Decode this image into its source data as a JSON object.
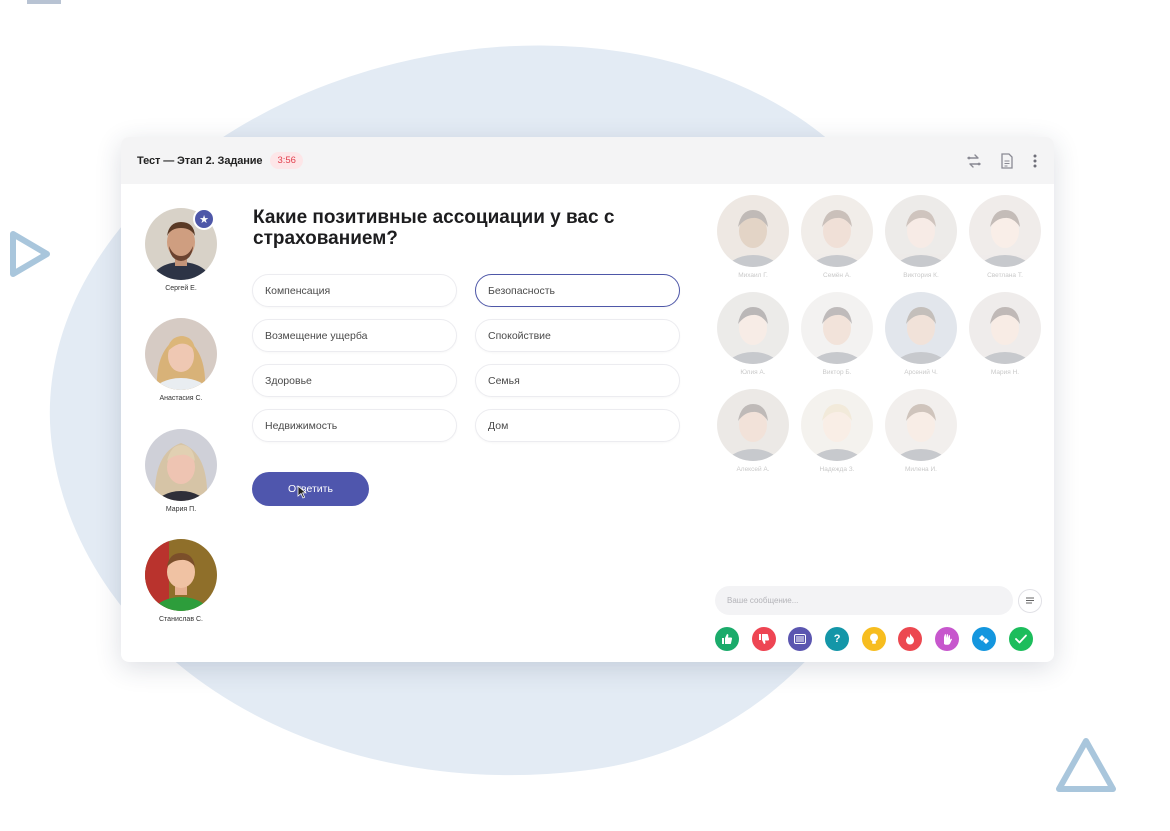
{
  "window": {
    "title": "Тест — Этап 2. Задание",
    "timer": "3:56",
    "toolbar_icons": [
      "swap-icon",
      "document-icon",
      "more-vertical-icon"
    ]
  },
  "participants": [
    {
      "name": "Сергей Е.",
      "badge": "star-icon"
    },
    {
      "name": "Анастасия С."
    },
    {
      "name": "Мария П."
    },
    {
      "name": "Станислав С."
    }
  ],
  "question": {
    "text": "Какие позитивные ассоциации у вас с страхованием?",
    "answers": [
      {
        "label": "Компенсация",
        "selected": false
      },
      {
        "label": "Безопасность",
        "selected": true
      },
      {
        "label": "Возмещение ущерба",
        "selected": false
      },
      {
        "label": "Спокойствие",
        "selected": false
      },
      {
        "label": "Здоровье",
        "selected": false
      },
      {
        "label": "Семья",
        "selected": false
      },
      {
        "label": "Недвижимость",
        "selected": false
      },
      {
        "label": "Дом",
        "selected": false
      }
    ],
    "submit_label": "Ответить"
  },
  "grid": [
    {
      "name": "Михаил Г."
    },
    {
      "name": "Семён А."
    },
    {
      "name": "Виктория К."
    },
    {
      "name": "Светлана Т."
    },
    {
      "name": "Юлия А."
    },
    {
      "name": "Виктор Б."
    },
    {
      "name": "Арсений Ч."
    },
    {
      "name": "Мария Н."
    },
    {
      "name": "Алексей А."
    },
    {
      "name": "Надежда З."
    },
    {
      "name": "Милена И."
    }
  ],
  "chat": {
    "placeholder": "Ваше сообщение...",
    "reactions": [
      {
        "icon": "thumbs-up-icon",
        "color": "#1bab6b"
      },
      {
        "icon": "thumbs-down-icon",
        "color": "#ee4553"
      },
      {
        "icon": "barcode-icon",
        "color": "#5b56b0"
      },
      {
        "icon": "question-icon",
        "color": "#1496a8",
        "glyph": "?"
      },
      {
        "icon": "lightbulb-icon",
        "color": "#f7bd1f"
      },
      {
        "icon": "fire-icon",
        "color": "#ec4850"
      },
      {
        "icon": "hand-icon",
        "color": "#c757cd"
      },
      {
        "icon": "handshake-icon",
        "color": "#1496de"
      },
      {
        "icon": "check-icon",
        "color": "#1cbd5c"
      }
    ]
  }
}
